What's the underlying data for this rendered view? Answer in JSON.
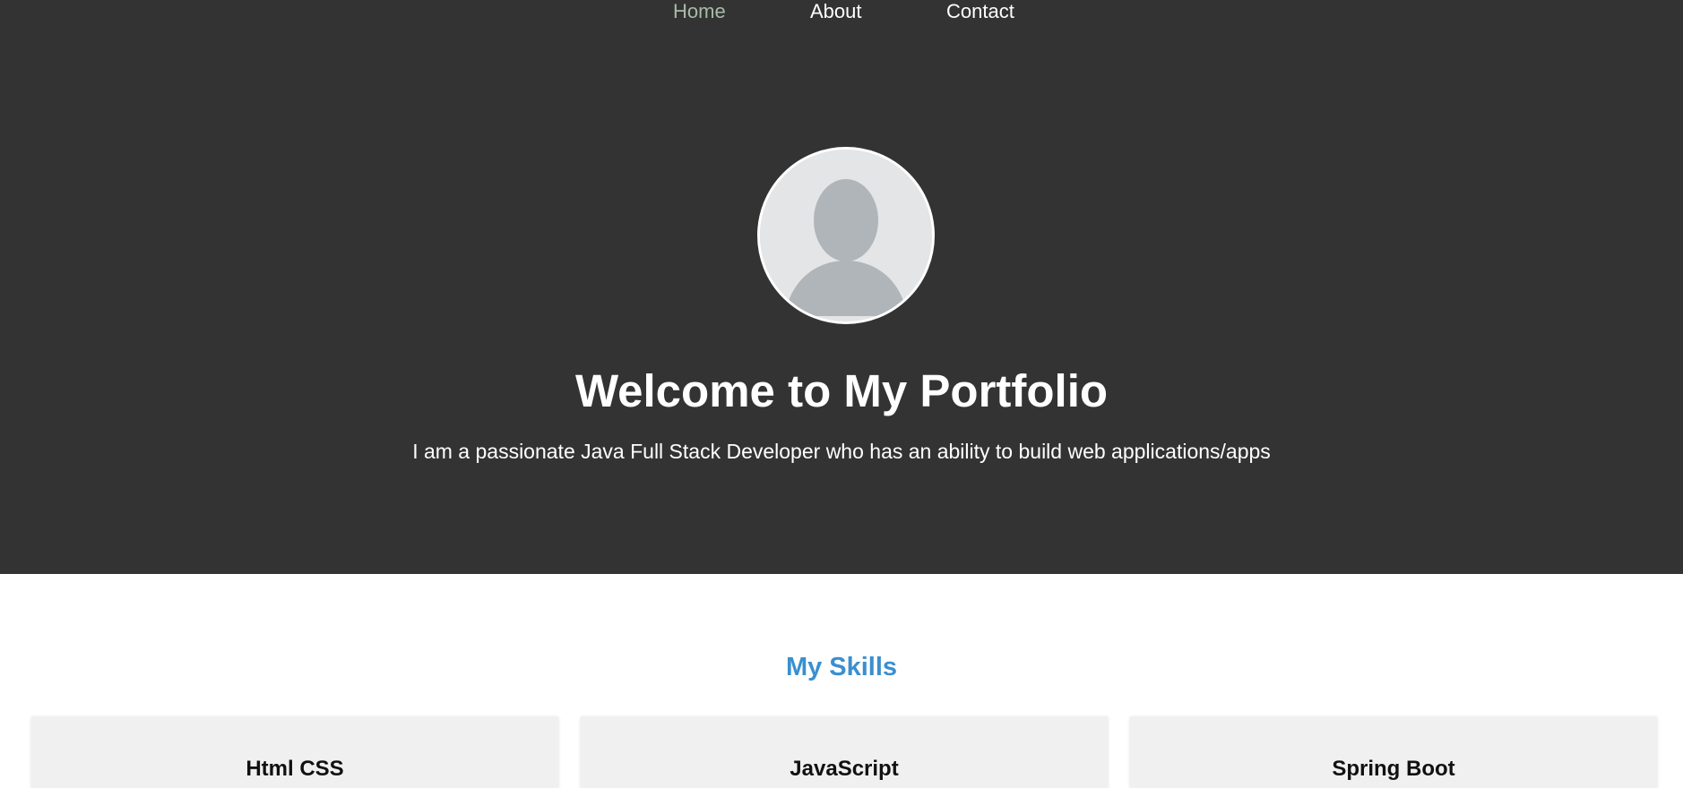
{
  "nav": {
    "items": [
      {
        "label": "Home",
        "active": true
      },
      {
        "label": "About",
        "active": false
      },
      {
        "label": "Contact",
        "active": false
      }
    ]
  },
  "hero": {
    "title": "Welcome to My Portfolio",
    "subtitle": "I am a passionate Java Full Stack Developer who has an ability to build web applications/apps"
  },
  "skills": {
    "heading": "My Skills",
    "cards": [
      {
        "title": "Html CSS"
      },
      {
        "title": "JavaScript"
      },
      {
        "title": "Spring Boot"
      }
    ]
  },
  "colors": {
    "hero_background": "#333333",
    "nav_active": "#a8bba8",
    "skills_heading": "#3a8fd0",
    "card_background": "#f0f0f0"
  }
}
